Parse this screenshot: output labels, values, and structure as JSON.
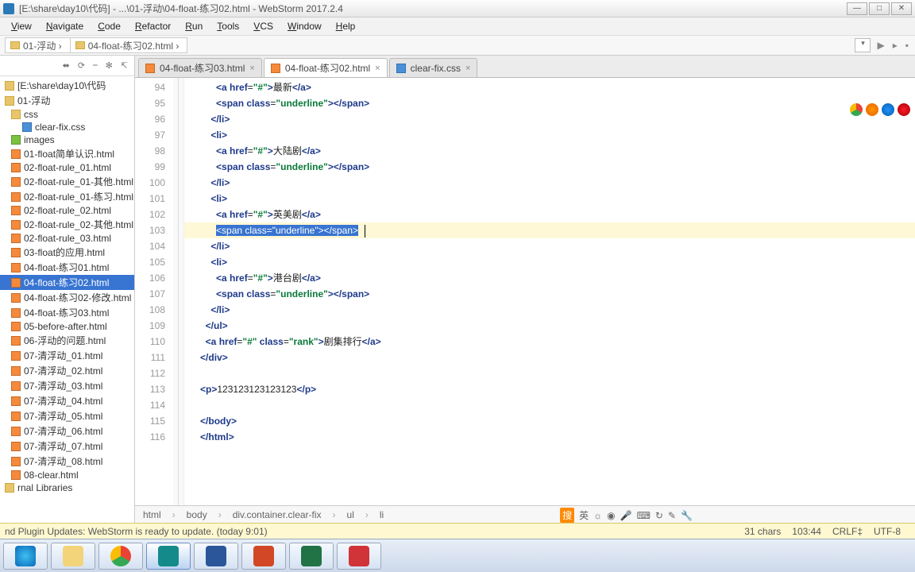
{
  "window": {
    "title": "[E:\\share\\day10\\代码] - ...\\01-浮动\\04-float-练习02.html - WebStorm 2017.2.4"
  },
  "menu": [
    "View",
    "Navigate",
    "Code",
    "Refactor",
    "Run",
    "Tools",
    "VCS",
    "Window",
    "Help"
  ],
  "nav_crumbs": [
    "01-浮动",
    "04-float-练习02.html"
  ],
  "sidebar": {
    "path": "[E:\\share\\day10\\代码",
    "items": [
      {
        "label": "01-浮动",
        "icon": "folder",
        "lvl": 1
      },
      {
        "label": "css",
        "icon": "folder",
        "lvl": 2
      },
      {
        "label": "clear-fix.css",
        "icon": "css",
        "lvl": 2,
        "indent": 3
      },
      {
        "label": "images",
        "icon": "img",
        "lvl": 2
      },
      {
        "label": "01-float简单认识.html",
        "icon": "html",
        "lvl": 2
      },
      {
        "label": "02-float-rule_01.html",
        "icon": "html",
        "lvl": 2
      },
      {
        "label": "02-float-rule_01-其他.html",
        "icon": "html",
        "lvl": 2
      },
      {
        "label": "02-float-rule_01-练习.html",
        "icon": "html",
        "lvl": 2
      },
      {
        "label": "02-float-rule_02.html",
        "icon": "html",
        "lvl": 2
      },
      {
        "label": "02-float-rule_02-其他.html",
        "icon": "html",
        "lvl": 2
      },
      {
        "label": "02-float-rule_03.html",
        "icon": "html",
        "lvl": 2
      },
      {
        "label": "03-float的应用.html",
        "icon": "html",
        "lvl": 2
      },
      {
        "label": "04-float-练习01.html",
        "icon": "html",
        "lvl": 2
      },
      {
        "label": "04-float-练习02.html",
        "icon": "html",
        "lvl": 2,
        "selected": true
      },
      {
        "label": "04-float-练习02-修改.html",
        "icon": "html",
        "lvl": 2
      },
      {
        "label": "04-float-练习03.html",
        "icon": "html",
        "lvl": 2
      },
      {
        "label": "05-before-after.html",
        "icon": "html",
        "lvl": 2
      },
      {
        "label": "06-浮动的问题.html",
        "icon": "html",
        "lvl": 2
      },
      {
        "label": "07-清浮动_01.html",
        "icon": "html",
        "lvl": 2
      },
      {
        "label": "07-清浮动_02.html",
        "icon": "html",
        "lvl": 2
      },
      {
        "label": "07-清浮动_03.html",
        "icon": "html",
        "lvl": 2
      },
      {
        "label": "07-清浮动_04.html",
        "icon": "html",
        "lvl": 2
      },
      {
        "label": "07-清浮动_05.html",
        "icon": "html",
        "lvl": 2
      },
      {
        "label": "07-清浮动_06.html",
        "icon": "html",
        "lvl": 2
      },
      {
        "label": "07-清浮动_07.html",
        "icon": "html",
        "lvl": 2
      },
      {
        "label": "07-清浮动_08.html",
        "icon": "html",
        "lvl": 2
      },
      {
        "label": "08-clear.html",
        "icon": "html",
        "lvl": 2
      },
      {
        "label": "rnal Libraries",
        "icon": "folder",
        "lvl": 1
      }
    ]
  },
  "tabs": [
    {
      "label": "04-float-练习03.html",
      "icon": "html"
    },
    {
      "label": "04-float-练习02.html",
      "icon": "html",
      "active": true
    },
    {
      "label": "clear-fix.css",
      "icon": "css"
    }
  ],
  "gutter_start": 94,
  "gutter_end": 116,
  "code_lines": [
    {
      "indent": 24,
      "html": "<span class='tag'>&lt;a</span> <span class='attr'>href</span><span class='eq'>=</span><span class='str'>\"#\"</span><span class='tag'>&gt;</span><span class='txt'>最新</span><span class='tag'>&lt;/a&gt;</span>"
    },
    {
      "indent": 24,
      "html": "<span class='tag'>&lt;span</span> <span class='attr'>class</span><span class='eq'>=</span><span class='str'>\"underline\"</span><span class='tag'>&gt;&lt;/span&gt;</span>"
    },
    {
      "indent": 20,
      "html": "<span class='tag'>&lt;/li&gt;</span>"
    },
    {
      "indent": 20,
      "html": "<span class='tag'>&lt;li&gt;</span>"
    },
    {
      "indent": 24,
      "html": "<span class='tag'>&lt;a</span> <span class='attr'>href</span><span class='eq'>=</span><span class='str'>\"#\"</span><span class='tag'>&gt;</span><span class='txt'>大陆剧</span><span class='tag'>&lt;/a&gt;</span>"
    },
    {
      "indent": 24,
      "html": "<span class='tag'>&lt;span</span> <span class='attr'>class</span><span class='eq'>=</span><span class='str'>\"underline\"</span><span class='tag'>&gt;&lt;/span&gt;</span>"
    },
    {
      "indent": 20,
      "html": "<span class='tag'>&lt;/li&gt;</span>"
    },
    {
      "indent": 20,
      "html": "<span class='tag'>&lt;li&gt;</span>"
    },
    {
      "indent": 24,
      "html": "<span class='tag'>&lt;a</span> <span class='attr'>href</span><span class='eq'>=</span><span class='str'>\"#\"</span><span class='tag'>&gt;</span><span class='txt'>英美剧</span><span class='tag'>&lt;/a&gt;</span>"
    },
    {
      "indent": 24,
      "hl": true,
      "html": "<span class='sel'>&lt;span class=\"underline\"&gt;&lt;/span&gt;</span><span class='cursor'></span>"
    },
    {
      "indent": 20,
      "html": "<span class='tag'>&lt;/li&gt;</span>"
    },
    {
      "indent": 20,
      "html": "<span class='tag'>&lt;li&gt;</span>"
    },
    {
      "indent": 24,
      "html": "<span class='tag'>&lt;a</span> <span class='attr'>href</span><span class='eq'>=</span><span class='str'>\"#\"</span><span class='tag'>&gt;</span><span class='txt'>港台剧</span><span class='tag'>&lt;/a&gt;</span>"
    },
    {
      "indent": 24,
      "html": "<span class='tag'>&lt;span</span> <span class='attr'>class</span><span class='eq'>=</span><span class='str'>\"underline\"</span><span class='tag'>&gt;&lt;/span&gt;</span>"
    },
    {
      "indent": 20,
      "html": "<span class='tag'>&lt;/li&gt;</span>"
    },
    {
      "indent": 16,
      "html": "<span class='tag'>&lt;/ul&gt;</span>"
    },
    {
      "indent": 16,
      "html": "<span class='tag'>&lt;a</span> <span class='attr'>href</span><span class='eq'>=</span><span class='str'>\"#\"</span> <span class='attr'>class</span><span class='eq'>=</span><span class='str'>\"rank\"</span><span class='tag'>&gt;</span><span class='txt'>剧集排行</span><span class='tag'>&lt;/a&gt;</span>"
    },
    {
      "indent": 12,
      "html": "<span class='tag'>&lt;/div&gt;</span>"
    },
    {
      "indent": 12,
      "html": ""
    },
    {
      "indent": 12,
      "html": "<span class='tag'>&lt;p&gt;</span><span class='txt'>123123123123123</span><span class='tag'>&lt;/p&gt;</span>"
    },
    {
      "indent": 12,
      "html": ""
    },
    {
      "indent": 12,
      "html": "<span class='tag'>&lt;/body&gt;</span>"
    },
    {
      "indent": 12,
      "html": "<span class='tag'>&lt;/html&gt;</span>"
    }
  ],
  "breadcrumb": [
    "html",
    "body",
    "div.container.clear-fix",
    "ul",
    "li"
  ],
  "status": {
    "update_msg": "nd Plugin Updates: WebStorm is ready to update. (today 9:01)",
    "chars": "31 chars",
    "pos": "103:44",
    "lineend": "CRLF‡",
    "enc": "UTF-8"
  },
  "tray": {
    "ime": "搜",
    "lang": "英"
  }
}
